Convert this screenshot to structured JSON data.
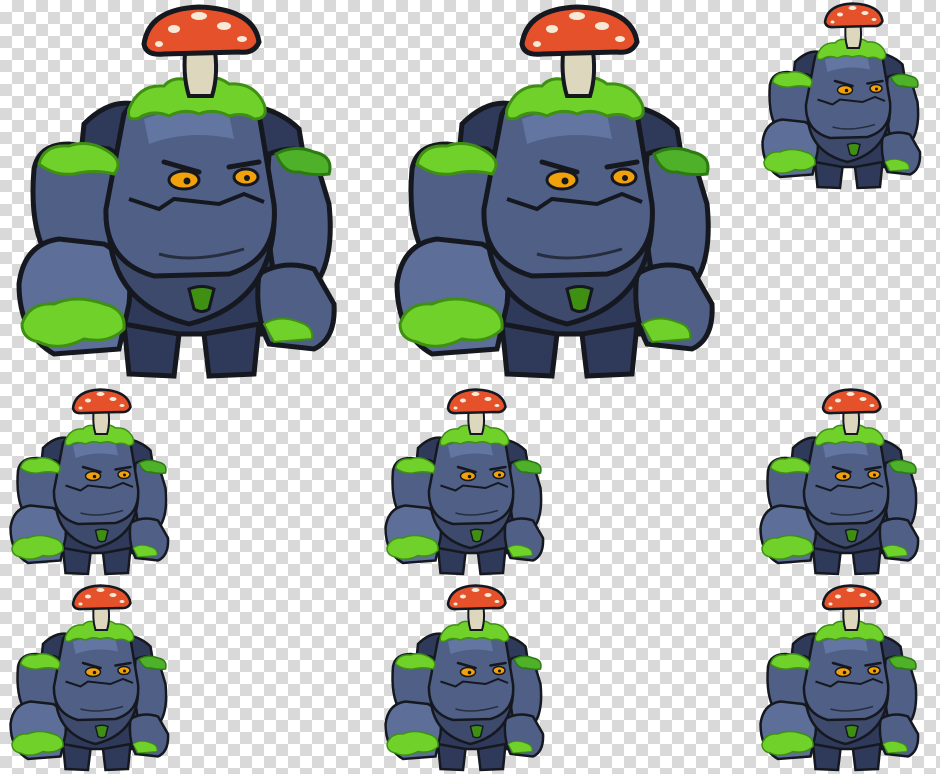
{
  "sheet": {
    "background": "transparency-checkerboard",
    "checker_colors": [
      "#ffffff",
      "#d9d9d9"
    ],
    "frame_count": 9,
    "frame_size_labels": [
      "large",
      "large",
      "small",
      "small",
      "small",
      "small",
      "small",
      "small",
      "small"
    ]
  },
  "palette": {
    "stone": "#4f5f86",
    "stone_dark": "#2f3a5a",
    "stone_light": "#7288b4",
    "outline": "#15181f",
    "moss": "#6fd12a",
    "moss_dark": "#3e8f12",
    "mushroom_cap": "#e4512a",
    "mushroom_spots": "#f6ead7",
    "mushroom_stem": "#ddd7bd",
    "eye": "#f1a10c"
  },
  "icons": {
    "frame": "stone-golem-with-mushroom"
  }
}
